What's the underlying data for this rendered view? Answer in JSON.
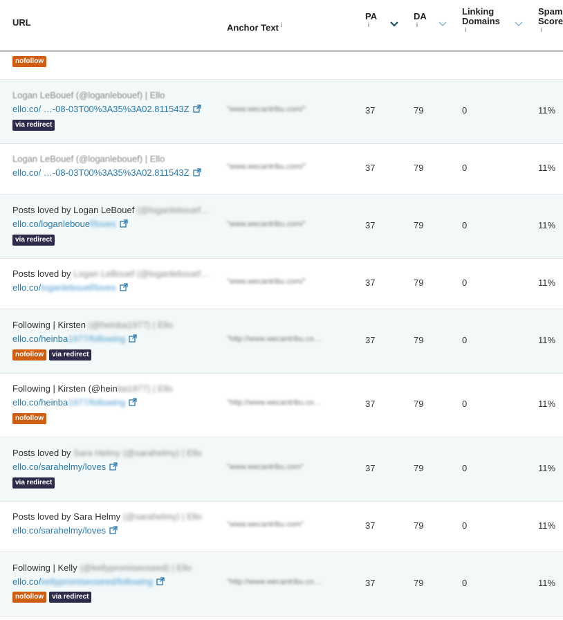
{
  "header": {
    "url": "URL",
    "anchor_text": "Anchor Text",
    "pa": "PA",
    "da": "DA",
    "linking_domains_line1": "Linking",
    "linking_domains_line2": "Domains",
    "spam_score_line1": "Spam",
    "spam_score_line2": "Score",
    "info_glyph": "i"
  },
  "partial_row": {
    "badge": "nofollow"
  },
  "badges": {
    "nofollow": "nofollow",
    "via_redirect": "via redirect"
  },
  "rows": [
    {
      "title": "",
      "title_blur": "Logan LeBouef (@loganlebouef) | Ello",
      "link": "ello.co/ …-08-03T00%3A35%3A02.811543Z",
      "link_blur": "",
      "anchor": "\"www.wecantribu.com/\"",
      "pa": "37",
      "da": "79",
      "ld": "0",
      "spam": "11%"
    },
    {
      "title": "",
      "title_blur": "Logan LeBouef (@loganlebouef) | Ello",
      "link": "ello.co/ …-08-03T00%3A35%3A02.811543Z",
      "link_blur": "",
      "anchor": "\"www.wecantribu.com/\"",
      "pa": "37",
      "da": "79",
      "ld": "0",
      "spam": "11%"
    },
    {
      "title": "Posts loved by Logan LeBouef",
      "title_blur": " (@loganlebouef…",
      "link": "ello.co/loganleboue",
      "link_blur": "f/loves",
      "anchor": "\"www.wecantribu.com/\"",
      "pa": "37",
      "da": "79",
      "ld": "0",
      "spam": "11%"
    },
    {
      "title": "Posts loved by",
      "title_blur": " Logan LeBouef (@loganlebouef…",
      "link": "ello.co/",
      "link_blur": "loganlebouef/loves",
      "anchor": "\"www.wecantribu.com/\"",
      "pa": "37",
      "da": "79",
      "ld": "0",
      "spam": "11%"
    },
    {
      "title": "Following | Kirsten",
      "title_blur": " (@heinba1977) | Ello",
      "link": "ello.co/heinba",
      "link_blur": "1977/following",
      "anchor": "\"http://www.wecantribu.co…",
      "pa": "37",
      "da": "79",
      "ld": "0",
      "spam": "11%"
    },
    {
      "title": "Following | Kirsten (@hein",
      "title_blur": "ba1977) | Ello",
      "link": "ello.co/heinba",
      "link_blur": "1977/following",
      "anchor": "\"http://www.wecantribu.co…",
      "pa": "37",
      "da": "79",
      "ld": "0",
      "spam": "11%"
    },
    {
      "title": "Posts loved by",
      "title_blur": " Sara Helmy (@sarahelmy) | Ello",
      "link": "ello.co/sarahelmy/loves",
      "link_blur": "",
      "anchor": "\"www.wecantribu.com\"",
      "pa": "37",
      "da": "79",
      "ld": "0",
      "spam": "11%"
    },
    {
      "title": "Posts loved by Sara Helmy",
      "title_blur": " (@sarahelmy) | Ello",
      "link": "ello.co/sarahelmy/loves",
      "link_blur": "",
      "anchor": "\"www.wecantribu.com\"",
      "pa": "37",
      "da": "79",
      "ld": "0",
      "spam": "11%"
    },
    {
      "title": "Following | Kelly",
      "title_blur": " (@kellypromiseoseed) | Ello",
      "link": "ello.co/",
      "link_blur": "kellypromiseoseed/following",
      "anchor": "\"http://www.wecantribu.co…",
      "pa": "37",
      "da": "79",
      "ld": "0",
      "spam": "11%"
    }
  ],
  "colors": {
    "link": "#2a7ab0",
    "nofollow_badge": "#cf5d12",
    "redirect_badge": "#2e2a4a",
    "alt_row": "#f3f9f9"
  },
  "icons": {
    "external_link": "external-link-icon",
    "sort_active": "chevron-down-icon",
    "sort_inactive": "chevron-down-icon"
  }
}
